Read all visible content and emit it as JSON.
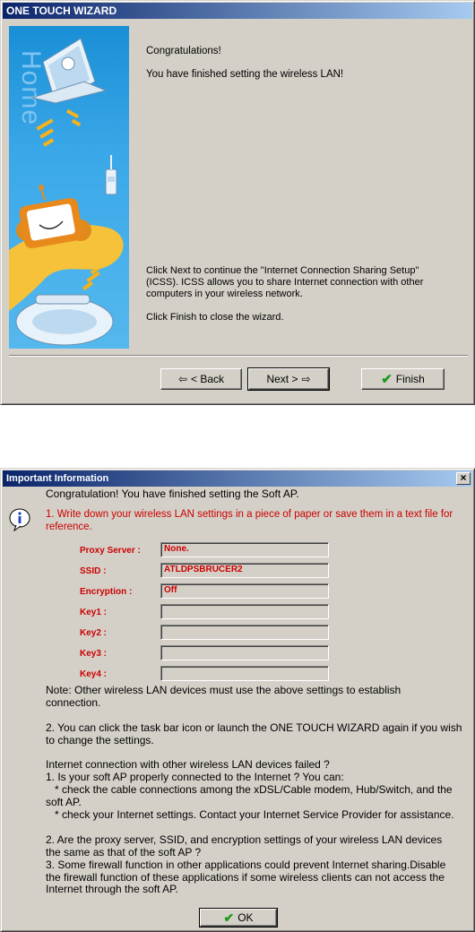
{
  "wizard": {
    "title": "ONE TOUCH WIZARD",
    "banner_text": "Home",
    "congrats": "Congratulations!",
    "finished": "You have finished setting the wireless LAN!",
    "next_info": "Click Next to continue the \"Internet Connection Sharing Setup\"(ICSS). ICSS allows you to share Internet connection with other computers in your wireless network.",
    "finish_info": "Click Finish to close the wizard.",
    "back_label": "< Back",
    "next_label": "Next >",
    "finish_label": "Finish"
  },
  "info": {
    "title": "Important Information",
    "close": "×",
    "intro": "Congratulation! You have finished setting the Soft AP.",
    "step1": "1. Write down your wireless LAN settings in a piece of paper or save them in a text file for reference.",
    "fields": [
      {
        "label": "Proxy Server :",
        "value": "None."
      },
      {
        "label": "SSID :",
        "value": "ATLDPSBRUCER2"
      },
      {
        "label": "Encryption :",
        "value": "Off"
      },
      {
        "label": "Key1 :",
        "value": ""
      },
      {
        "label": "Key2 :",
        "value": ""
      },
      {
        "label": "Key3 :",
        "value": ""
      },
      {
        "label": "Key4 :",
        "value": ""
      }
    ],
    "note": "Note: Other wireless LAN devices must use the above settings to establish connection.",
    "step2": "2. You can click the task bar icon or launch the ONE TOUCH WIZARD again if you wish to change the settings.",
    "troubleshoot": [
      "Internet connection with other wireless LAN devices failed ?",
      "1. Is your soft AP properly connected to the Internet ? You can:",
      "* check the cable connections among the xDSL/Cable modem, Hub/Switch, and the soft AP.",
      "* check your Internet settings. Contact your Internet Service Provider for assistance.",
      "2. Are the proxy server, SSID, and encryption settings of your wireless LAN devices the same as that of the soft AP ?",
      "3. Some firewall function in other applications could prevent Internet sharing.Disable the firewall function of these applications if some wireless clients can not access the Internet through the soft AP."
    ],
    "ok_label": "OK"
  }
}
